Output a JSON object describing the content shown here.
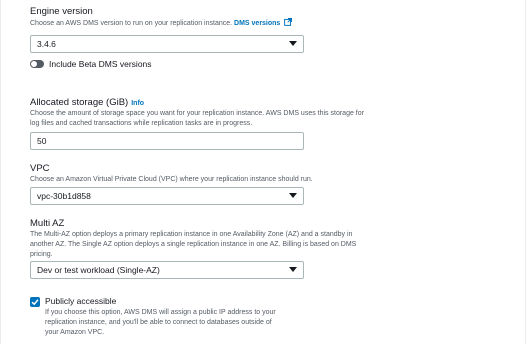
{
  "engine_version": {
    "label": "Engine version",
    "description": "Choose an AWS DMS version to run on your replication instance.",
    "link": "DMS versions",
    "selected": "3.4.6"
  },
  "beta_toggle": {
    "label": "Include Beta DMS versions",
    "checked": false
  },
  "allocated_storage": {
    "label": "Allocated storage (GiB)",
    "info": "Info",
    "description_line1": "Choose the amount of storage space you want for your replication instance. AWS DMS uses this storage for",
    "description_line2": "log files and cached transactions while replication tasks are in progress.",
    "value": "50"
  },
  "vpc": {
    "label": "VPC",
    "description": "Choose an Amazon Virtual Private Cloud (VPC) where your replication instance should run.",
    "selected": "vpc-30b1d858"
  },
  "multi_az": {
    "label": "Multi AZ",
    "description_line1": "The Multi-AZ option deploys a primary replication instance in one Availability Zone (AZ) and a standby in",
    "description_line2": "another AZ. The Single AZ option deploys a single replication instance in one AZ. Billing is based on DMS",
    "description_line3": "pricing.",
    "selected": "Dev or test workload (Single-AZ)"
  },
  "publicly_accessible": {
    "label": "Publicly accessible",
    "checked": true,
    "description_line1": "If you choose this option, AWS DMS will assign a public IP address to your",
    "description_line2": "replication instance, and you'll be able to connect to databases outside of",
    "description_line3": "your Amazon VPC."
  },
  "colors": {
    "link": "#0073bb",
    "text": "#16191f",
    "secondary_text": "#545b64",
    "border": "#aab7b8"
  }
}
